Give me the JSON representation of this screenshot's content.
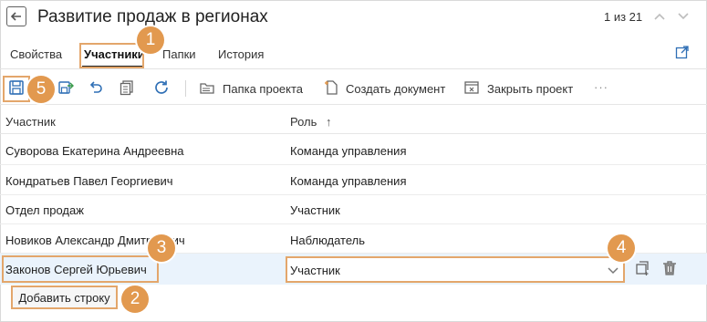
{
  "header": {
    "title": "Развитие продаж в регионах",
    "pager": "1 из 21"
  },
  "tabs": [
    {
      "label": "Свойства"
    },
    {
      "label": "Участники"
    },
    {
      "label": "Папки"
    },
    {
      "label": "История"
    }
  ],
  "toolbar": {
    "project_folder": "Папка проекта",
    "create_document": "Создать документ",
    "close_project": "Закрыть проект",
    "more": "···"
  },
  "table": {
    "columns": [
      "Участник",
      "Роль"
    ],
    "sort_indicator": "↑",
    "rows": [
      {
        "participant": "Суворова Екатерина Андреевна",
        "role": "Команда управления"
      },
      {
        "participant": "Кондратьев Павел Георгиевич",
        "role": "Команда управления"
      },
      {
        "participant": "Отдел продаж",
        "role": "Участник"
      },
      {
        "participant": "Новиков Александр Дмитриевич",
        "role": "Наблюдатель"
      },
      {
        "participant": "Законов Сергей Юрьевич",
        "role": "Участник"
      }
    ],
    "add_row": "Добавить строку"
  },
  "callouts": [
    "1",
    "2",
    "3",
    "4",
    "5"
  ],
  "colors": {
    "accent": "#e2994f",
    "selected_row": "#eaf3fc",
    "icon_blue": "#2f6fb5"
  }
}
